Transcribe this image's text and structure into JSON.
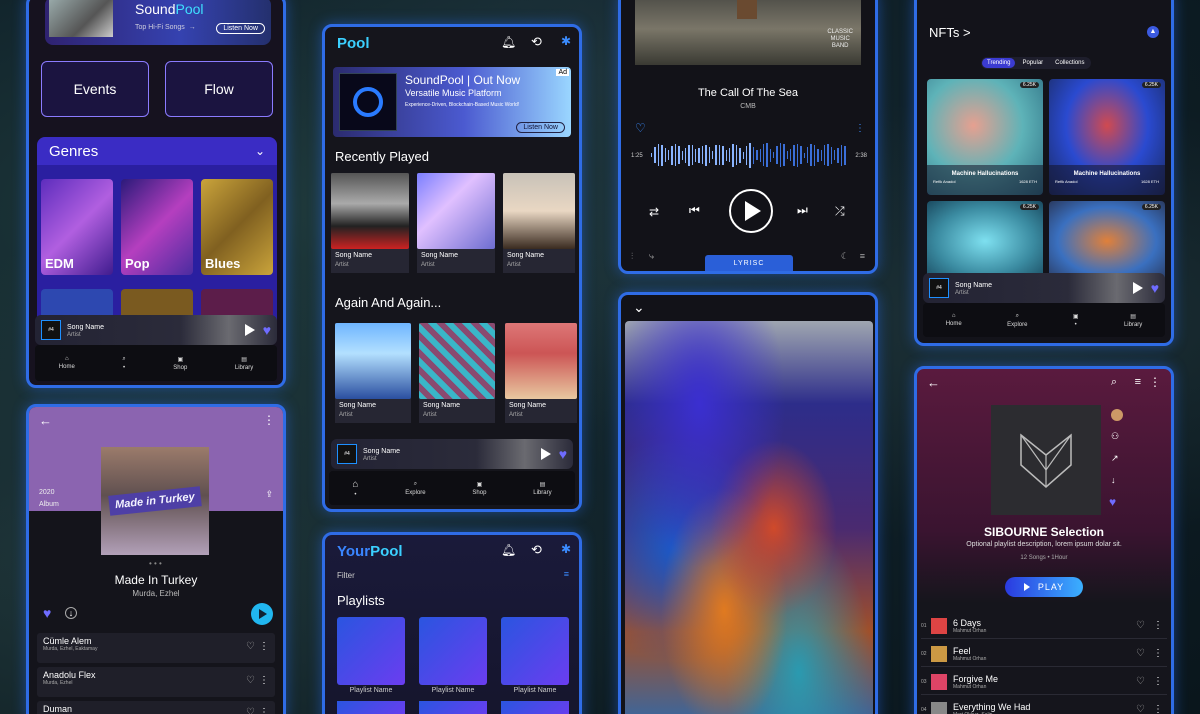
{
  "p1": {
    "banner_title_a": "Sound",
    "banner_title_b": "Pool",
    "banner_sub": "Top Hi-Fi Songs",
    "banner_arrow": "→",
    "banner_btn": "Listen Now",
    "btn_events": "Events",
    "btn_flow": "Flow",
    "genres": "Genres",
    "tiles": [
      "EDM",
      "Pop",
      "Blues"
    ],
    "mini_song": "Song Name",
    "mini_artist": "Artist",
    "mini_tag": "#4",
    "nav": [
      "Home",
      "",
      "Shop",
      "Library"
    ]
  },
  "p2": {
    "title": "Pool",
    "ad_title": "SoundPool | Out Now",
    "ad_sub": "Versatile Music Platform",
    "ad_desc": "Experience-Driven, Blockchain-Based Music World!",
    "ad_btn": "Listen Now",
    "ad_badge": "Ad",
    "recent": "Recently Played",
    "again": "Again And Again...",
    "cards": [
      {
        "song": "Song Name",
        "artist": "Artist"
      },
      {
        "song": "Song Name",
        "artist": "Artist"
      },
      {
        "song": "Song Name",
        "artist": "Artist"
      }
    ],
    "mini_song": "Song Name",
    "mini_artist": "Artist",
    "mini_tag": "#4",
    "nav": [
      "Home",
      "Explore",
      "Shop",
      "Library"
    ]
  },
  "p3": {
    "art_text_1": "CLASSIC",
    "art_text_2": "MUSIC",
    "art_text_3": "BAND",
    "song": "The Call Of The Sea",
    "artist": "CMB",
    "t_start": "1:25",
    "t_end": "2:38",
    "tab": "LYRISC"
  },
  "p4": {
    "title": "NFTs",
    "arrow": ">",
    "tabs": [
      "Trending",
      "Popular",
      "Collections"
    ],
    "nft_title": "Machine Hallucinations",
    "nft_owner": "Refik Anadol",
    "nft_price": "1628 ETH",
    "nft_badge": "6.25K",
    "mini_song": "Song Name",
    "mini_artist": "Artist",
    "mini_tag": "#4",
    "nav": [
      "Home",
      "Explore",
      "",
      "Library"
    ]
  },
  "p5": {
    "year": "2020",
    "kind": "Album",
    "album_text": "Made in Turkey",
    "title": "Made In Turkey",
    "artists": "Murda, Ezhel",
    "tracks": [
      {
        "name": "Cümle Alem",
        "artist": "Murda, Ezhel, Eaktamay"
      },
      {
        "name": "Anadolu Flex",
        "artist": "Murda, Ezhel"
      },
      {
        "name": "Duman",
        "artist": ""
      }
    ]
  },
  "p6": {
    "title_a": "Your",
    "title_b": "Pool",
    "filter": "Filter",
    "playlists": "Playlists",
    "items": [
      "Playlist Name",
      "Playlist Name",
      "Playlist Name"
    ]
  },
  "p8": {
    "title": "SIBOURNE Selection",
    "desc": "Optional playlist description, lorem ipsum dolar sit.",
    "meta": "12 Songs • 1Hour",
    "play": "PLAY",
    "tracks": [
      {
        "n": "01",
        "name": "6 Days",
        "artist": "Mahmut Orhan"
      },
      {
        "n": "02",
        "name": "Feel",
        "artist": "Mahmut Orhan"
      },
      {
        "n": "03",
        "name": "Forgive Me",
        "artist": "Mahmut Orhan"
      },
      {
        "n": "04",
        "name": "Everything We Had",
        "artist": "Mert Okkuz, Salin"
      }
    ]
  }
}
